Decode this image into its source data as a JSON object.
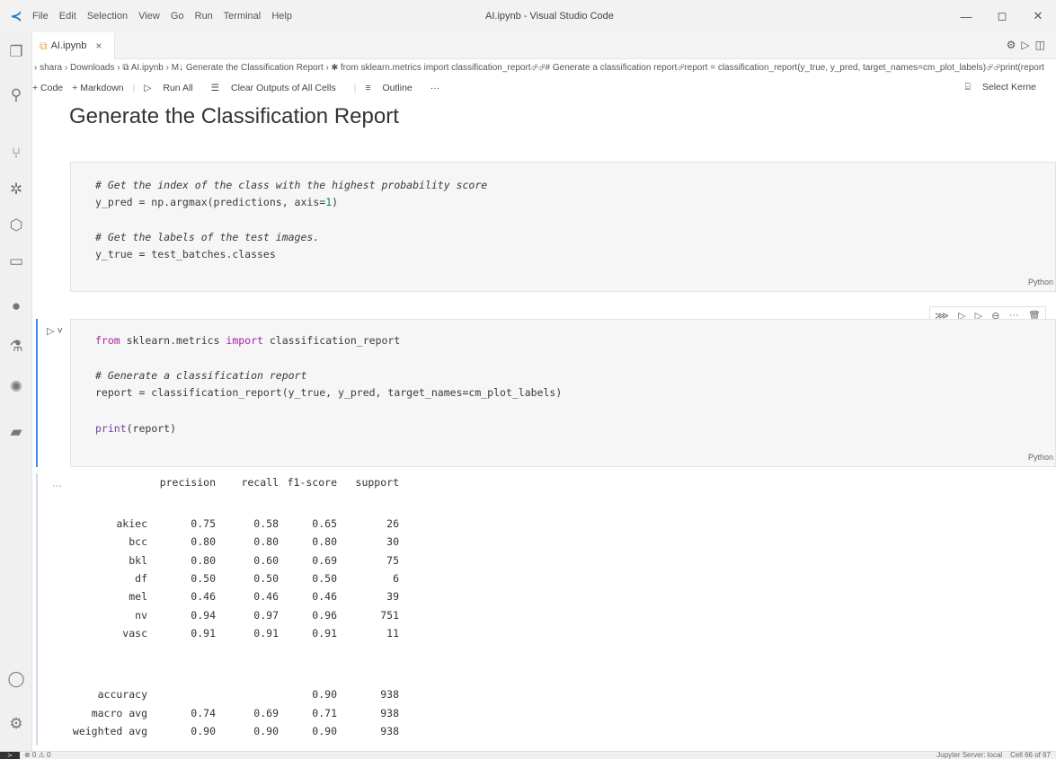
{
  "window": {
    "menu": [
      "File",
      "Edit",
      "Selection",
      "View",
      "Go",
      "Run",
      "Terminal",
      "Help"
    ],
    "title": "AI.ipynb - Visual Studio Code",
    "controls": [
      "—",
      "◻",
      "✕"
    ]
  },
  "activity_icons": [
    "files-icon",
    "search-icon",
    "source-control-icon",
    "debug-icon",
    "extensions-icon",
    "remote-explorer-icon",
    "spotify-icon",
    "testing-icon",
    "jupyter-icon",
    "docker-icon",
    "account-icon",
    "settings-gear-icon"
  ],
  "tab": {
    "label": "AI.ipynb",
    "close": "×"
  },
  "breadcrumb": "› shara › Downloads › ⧉ AI.ipynb › M↓ Generate the Classification Report › ✱ from sklearn.metrics import classification_report⏎⏎# Generate a classification report⏎report = classification_report(y_true, y_pred, target_names=cm_plot_labels)⏎⏎print(report",
  "toolbar": {
    "code": "+ Code",
    "markdown": "+ Markdown",
    "run_all": "Run All",
    "clear_outputs": "Clear Outputs of All Cells",
    "outline": "Outline",
    "more": "···",
    "select_kernel": "Select Kerne"
  },
  "markdown_heading": "Generate the Classification Report",
  "cell1": {
    "lines": [
      {
        "comment": "# Get the index of the class with the highest probability score"
      },
      {
        "code": "y_pred = np.argmax(predictions, axis=",
        "num": "1",
        "end": ")"
      },
      {
        "comment": "# Get the labels of the test images."
      },
      {
        "code": "y_true = test_batches.classes"
      }
    ],
    "language": "Python"
  },
  "cell2": {
    "line1": {
      "kw1": "from",
      "mid1": " sklearn.metrics ",
      "kw2": "import",
      "rest": " classification_report"
    },
    "line2": "# Generate a classification report",
    "line3": "report = classification_report(y_true, y_pred, target_names=cm_plot_labels)",
    "line4": {
      "fn": "print",
      "rest": "(report)"
    },
    "language": "Python"
  },
  "output": {
    "more": "···",
    "headers": [
      "precision",
      "recall",
      "f1-score",
      "support"
    ],
    "rows": [
      {
        "label": "akiec",
        "precision": "0.75",
        "recall": "0.58",
        "f1": "0.65",
        "support": "26"
      },
      {
        "label": "bcc",
        "precision": "0.80",
        "recall": "0.80",
        "f1": "0.80",
        "support": "30"
      },
      {
        "label": "bkl",
        "precision": "0.80",
        "recall": "0.60",
        "f1": "0.69",
        "support": "75"
      },
      {
        "label": "df",
        "precision": "0.50",
        "recall": "0.50",
        "f1": "0.50",
        "support": "6"
      },
      {
        "label": "mel",
        "precision": "0.46",
        "recall": "0.46",
        "f1": "0.46",
        "support": "39"
      },
      {
        "label": "nv",
        "precision": "0.94",
        "recall": "0.97",
        "f1": "0.96",
        "support": "751"
      },
      {
        "label": "vasc",
        "precision": "0.91",
        "recall": "0.91",
        "f1": "0.91",
        "support": "11"
      }
    ],
    "summary": [
      {
        "label": "accuracy",
        "precision": "",
        "recall": "",
        "f1": "0.90",
        "support": "938"
      },
      {
        "label": "macro avg",
        "precision": "0.74",
        "recall": "0.69",
        "f1": "0.71",
        "support": "938"
      },
      {
        "label": "weighted avg",
        "precision": "0.90",
        "recall": "0.90",
        "f1": "0.90",
        "support": "938"
      }
    ]
  },
  "statusbar": {
    "problems": "⊗ 0 ⚠ 0",
    "server": "Jupyter Server: local",
    "cell": "Cell 66 of 67"
  },
  "colors": {
    "accent": "#3b8eea",
    "keyword": "#a626a4",
    "comment": "#6a8d6a",
    "number": "#098658"
  }
}
